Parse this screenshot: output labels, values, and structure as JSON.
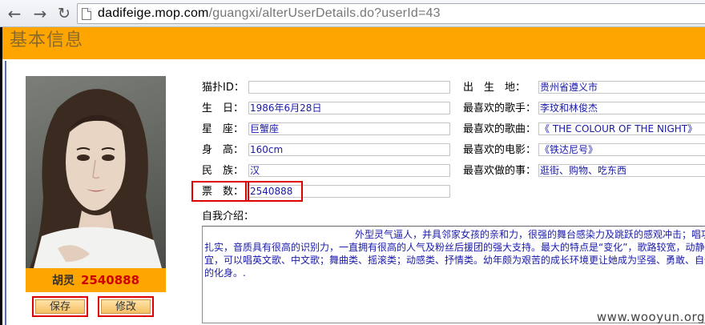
{
  "browser": {
    "url_domain": "dadifeige.mop.com",
    "url_path": "/guangxi/alterUserDetails.do?userId=43"
  },
  "section": {
    "title": "基本信息"
  },
  "profile": {
    "name": "胡灵",
    "votes": "2540888"
  },
  "buttons": {
    "save": "保存",
    "edit": "修改"
  },
  "form": {
    "left": [
      {
        "label": "猫扑ID：",
        "value": ""
      },
      {
        "label": "生　日：",
        "value": "1986年6月28日"
      },
      {
        "label": "星　座：",
        "value": "巨蟹座"
      },
      {
        "label": "身　高：",
        "value": "160cm"
      },
      {
        "label": "民　族：",
        "value": "汉"
      },
      {
        "label": "票　数：",
        "value": "2540888"
      }
    ],
    "right": [
      {
        "label": "出　生　地：",
        "value": "贵州省遵义市"
      },
      {
        "label": "最喜欢的歌手：",
        "value": "李玟和林俊杰"
      },
      {
        "label": "最喜欢的歌曲：",
        "value": "《 THE COLOUR OF THE NIGHT》"
      },
      {
        "label": "最喜欢的电影：",
        "value": "《铁达尼号》"
      },
      {
        "label": "最喜欢做的事：",
        "value": "逛街、购物、吃东西"
      }
    ],
    "intro_label": "自我介绍：",
    "intro_text": "外型灵气逼人，并具邻家女孩的亲和力，很强的舞台感染力及跳跃的感观冲击；唱功扎实，音质具有很高的识别力，一直拥有很高的人气及粉丝后援团的强大支持。最大的特点是“变化”，歌路较宽，动静皆宜，可以唱英文歌、中文歌；舞曲类、摇滚类；动感类、抒情类。幼年颇为艰苦的成长环境更让她成为坚强、勇敢、自信的化身。."
  },
  "watermark": "www.wooyun.org",
  "colors": {
    "header": "#ffa500",
    "highlight": "#e00000",
    "field_text": "#1a1aa8"
  }
}
